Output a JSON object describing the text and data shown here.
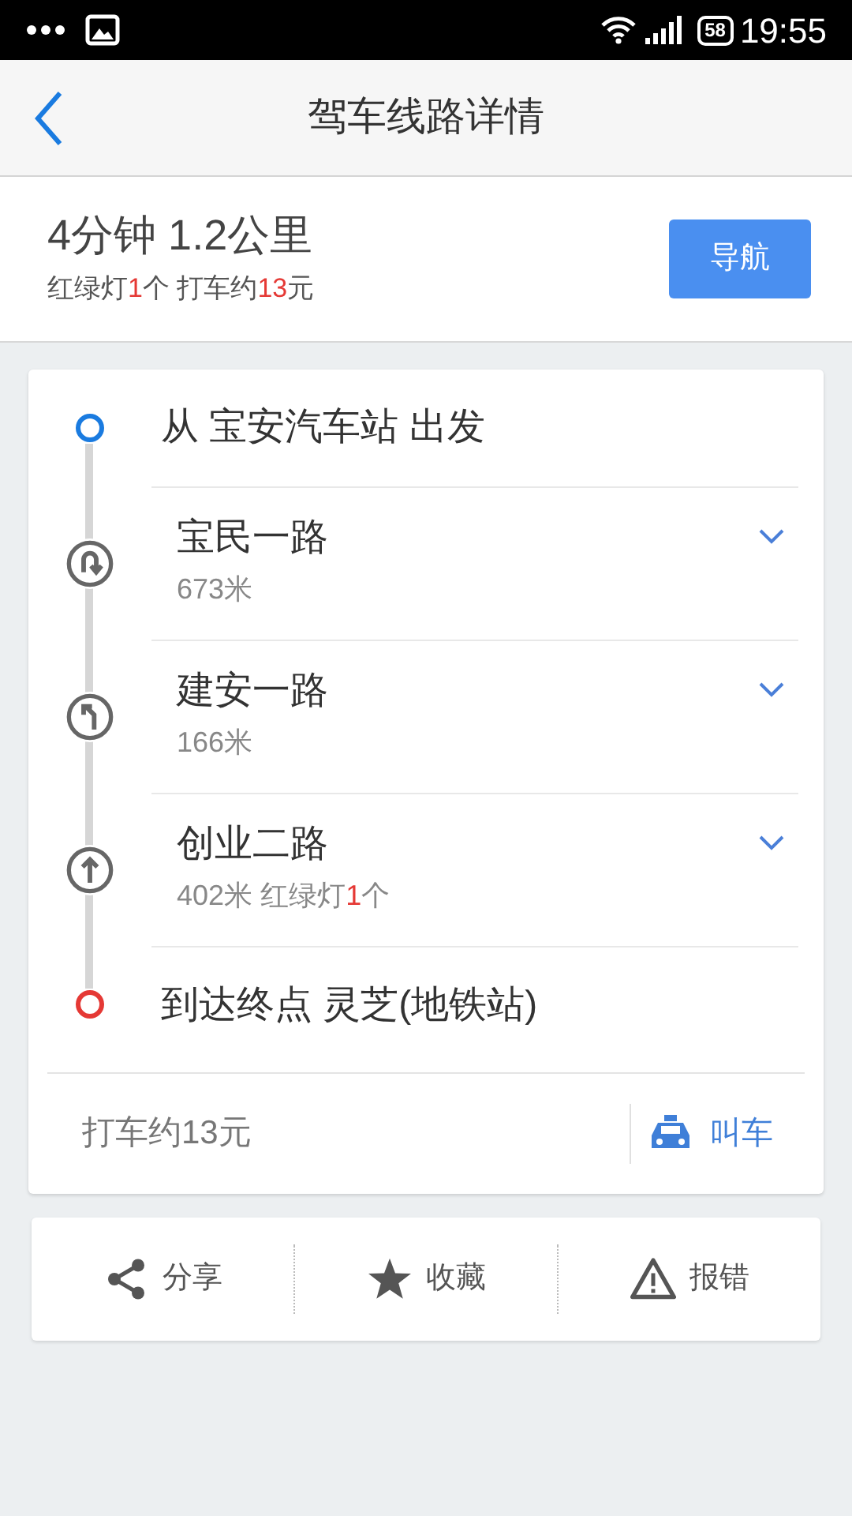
{
  "status_bar": {
    "battery": "58",
    "time": "19:55"
  },
  "header": {
    "title": "驾车线路详情"
  },
  "summary": {
    "duration": "4分钟",
    "distance": "1.2公里",
    "lights": {
      "label": "红绿灯",
      "count": "1",
      "unit": "个"
    },
    "taxi": {
      "label": "打车约",
      "amount": "13",
      "unit": "元"
    },
    "nav_button": "导航"
  },
  "route": [
    {
      "kind": "start",
      "text": "从 宝安汽车站 出发"
    },
    {
      "kind": "uturn",
      "road": "宝民一路",
      "distance": "673米",
      "expanded": false
    },
    {
      "kind": "left",
      "road": "建安一路",
      "distance": "166米",
      "expanded": false
    },
    {
      "kind": "straight",
      "road": "创业二路",
      "distance": "402米",
      "lights": {
        "label": "红绿灯",
        "count": "1",
        "unit": "个"
      },
      "expanded": false
    },
    {
      "kind": "end",
      "text": "到达终点 灵芝(地铁站)"
    }
  ],
  "footer": {
    "taxi_fare": "打车约13元",
    "call_taxi": "叫车"
  },
  "actions": [
    {
      "kind": "share",
      "label": "分享"
    },
    {
      "kind": "favorite",
      "label": "收藏"
    },
    {
      "kind": "report",
      "label": "报错"
    }
  ]
}
